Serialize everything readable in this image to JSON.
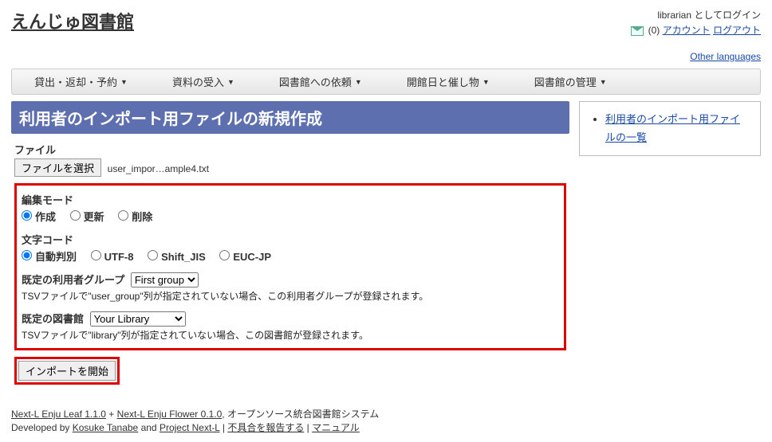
{
  "header": {
    "site_title": "えんじゅ図書館",
    "login_status": "librarian としてログイン",
    "mail_count": "(0)",
    "account_link": "アカウント",
    "logout_link": "ログアウト",
    "other_lang": "Other languages"
  },
  "menu": {
    "items": [
      "貸出・返却・予約",
      "資料の受入",
      "図書館への依頼",
      "開館日と催し物",
      "図書館の管理"
    ]
  },
  "page": {
    "title": "利用者のインポート用ファイルの新規作成"
  },
  "form": {
    "file_label": "ファイル",
    "file_button": "ファイルを選択",
    "file_name": "user_impor…ample4.txt",
    "edit_mode_label": "編集モード",
    "edit_modes": {
      "create": "作成",
      "update": "更新",
      "delete": "削除"
    },
    "charset_label": "文字コード",
    "charsets": {
      "auto": "自動判別",
      "utf8": "UTF-8",
      "sjis": "Shift_JIS",
      "eucjp": "EUC-JP"
    },
    "default_group_label": "既定の利用者グループ",
    "default_group_value": "First group",
    "default_group_help": "TSVファイルで\"user_group\"列が指定されていない場合、この利用者グループが登録されます。",
    "default_library_label": "既定の図書館",
    "default_library_value": "Your Library",
    "default_library_help": "TSVファイルで\"library\"列が指定されていない場合、この図書館が登録されます。",
    "submit": "インポートを開始"
  },
  "sidebar": {
    "link": "利用者のインポート用ファイルの一覧"
  },
  "footer": {
    "leaf": "Next-L Enju Leaf 1.1.0",
    "plus": " + ",
    "flower": "Next-L Enju Flower 0.1.0",
    "suffix": ", オープンソース統合図書館システム",
    "dev_prefix": "Developed by ",
    "dev_name": "Kosuke Tanabe",
    "dev_and": " and ",
    "dev_org": "Project Next-L",
    "sep": " | ",
    "report": "不具合を報告する",
    "manual": "マニュアル"
  }
}
